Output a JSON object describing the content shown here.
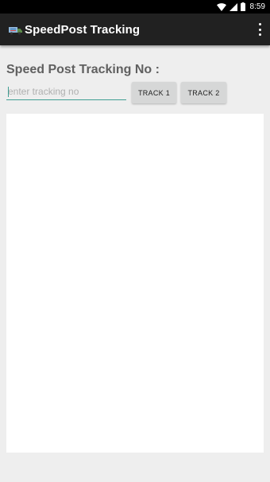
{
  "status_bar": {
    "time": "8:59",
    "icons": [
      "wifi-icon",
      "signal-icon",
      "battery-icon"
    ]
  },
  "app_bar": {
    "title": "SpeedPost Tracking",
    "app_icon": "truck-icon",
    "menu_icon": "overflow-menu-icon"
  },
  "form": {
    "heading": "Speed Post Tracking No :",
    "input_placeholder": "enter tracking no",
    "input_value": "",
    "track1_label": "TRACK 1",
    "track2_label": "TRACK 2"
  },
  "colors": {
    "status_bar": "#000000",
    "app_bar": "#212121",
    "background": "#eeeeee",
    "accent": "#3f9e93",
    "button": "#d6d7d7",
    "panel": "#ffffff"
  }
}
